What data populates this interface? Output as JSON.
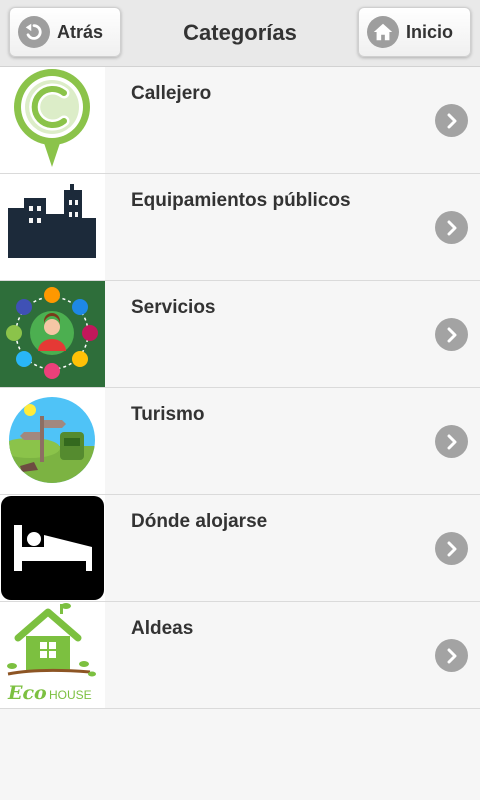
{
  "header": {
    "title": "Categorías",
    "back_label": "Atrás",
    "home_label": "Inicio"
  },
  "categories": [
    {
      "label": "Callejero",
      "icon": "map-pin-c-icon"
    },
    {
      "label": "Equipamientos públicos",
      "icon": "buildings-icon"
    },
    {
      "label": "Servicios",
      "icon": "customer-service-icon"
    },
    {
      "label": "Turismo",
      "icon": "tourism-icon"
    },
    {
      "label": "Dónde alojarse",
      "icon": "bed-icon"
    },
    {
      "label": "Aldeas",
      "icon": "eco-house-icon"
    }
  ],
  "eco_house": {
    "brand_main": "Eco",
    "brand_sub": "HOUSE"
  },
  "colors": {
    "header_bg": "#e9e9e9",
    "list_bg": "#f6f6f6",
    "text": "#333333",
    "chevron": "#a3a3a3",
    "pin_green": "#8bc34a",
    "building_navy": "#1c2a3a",
    "services_green": "#2e6e3a",
    "eco_green": "#7cc040"
  }
}
